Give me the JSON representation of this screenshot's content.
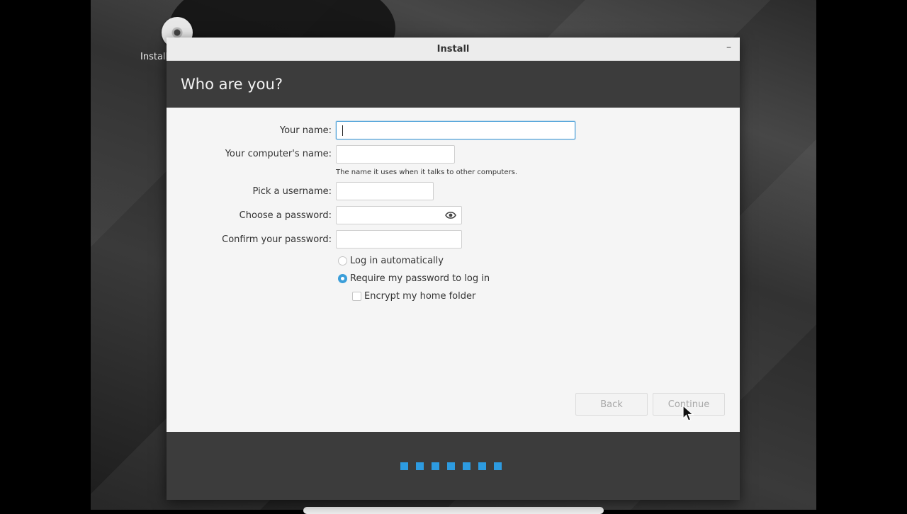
{
  "desktop": {
    "icon_label": "Install"
  },
  "window": {
    "title": "Install",
    "minimize_glyph": "–"
  },
  "header": {
    "title": "Who are you?"
  },
  "form": {
    "your_name": {
      "label": "Your name:",
      "value": ""
    },
    "computer_name": {
      "label": "Your computer's name:",
      "value": "",
      "hint": "The name it uses when it talks to other computers."
    },
    "username": {
      "label": "Pick a username:",
      "value": ""
    },
    "password": {
      "label": "Choose a password:",
      "value": "",
      "icon": "eye-icon"
    },
    "confirm_password": {
      "label": "Confirm your password:",
      "value": ""
    }
  },
  "login_options": {
    "auto_login": {
      "label": "Log in automatically",
      "selected": false
    },
    "require_password": {
      "label": "Require my password to log in",
      "selected": true
    },
    "encrypt_home": {
      "label": "Encrypt my home folder",
      "checked": false
    }
  },
  "buttons": {
    "back": "Back",
    "continue": "Continue"
  },
  "progress": {
    "steps_total": 7
  },
  "colors": {
    "accent": "#2d9be0",
    "header_bg": "#3c3c3c"
  }
}
